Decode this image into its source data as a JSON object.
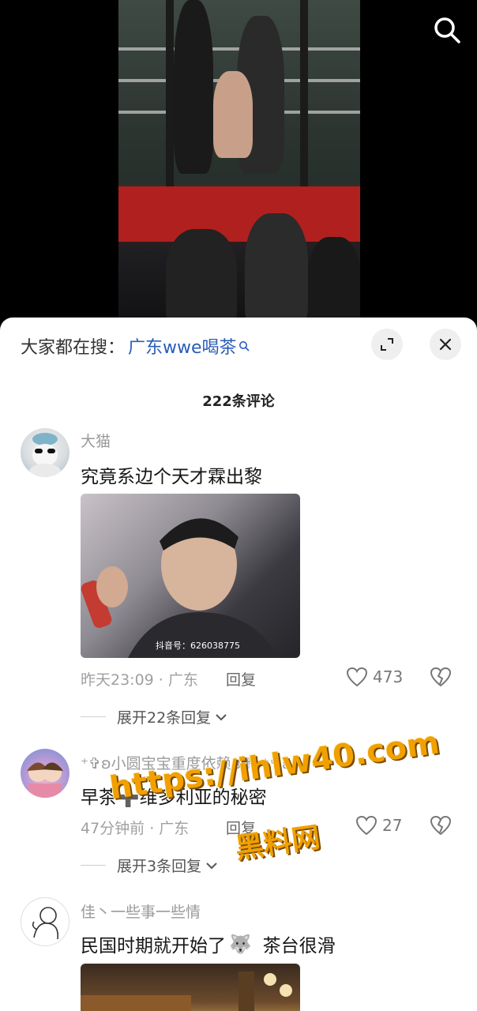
{
  "search_bar": {
    "prefix": "大家都在搜：",
    "term": "广东wwe喝茶"
  },
  "comment_count": "222条评论",
  "comments": [
    {
      "username": "大猫",
      "text": "究竟系边个天才霖出黎",
      "meme_watermark": "抖音号：626038775",
      "time_location": "昨天23:09 · 广东",
      "reply_label": "回复",
      "likes": "473",
      "expand": "展开22条回复"
    },
    {
      "username": "⁺✞ʚ小圆宝宝重度依赖ɞ✟₊⁺✞ʚ",
      "text": "早茶➕维多利亚的秘密",
      "time_location": "47分钟前 · 广东",
      "reply_label": "回复",
      "likes": "27",
      "expand": "展开3条回复"
    },
    {
      "username": "佳丶一些事一些情",
      "text_before": "民国时期就开始了",
      "emoji": "🐺",
      "text_after": "茶台很滑"
    }
  ],
  "overlay": {
    "url": "https://ihlw40.com",
    "site": "黑料网"
  },
  "icons": [
    "search-icon",
    "expand-icon",
    "close-icon",
    "heart-icon",
    "broken-heart-icon",
    "chevron-down-icon"
  ],
  "colors": {
    "link_blue": "#2a5cb8",
    "watermark_orange": "#f0a000"
  }
}
